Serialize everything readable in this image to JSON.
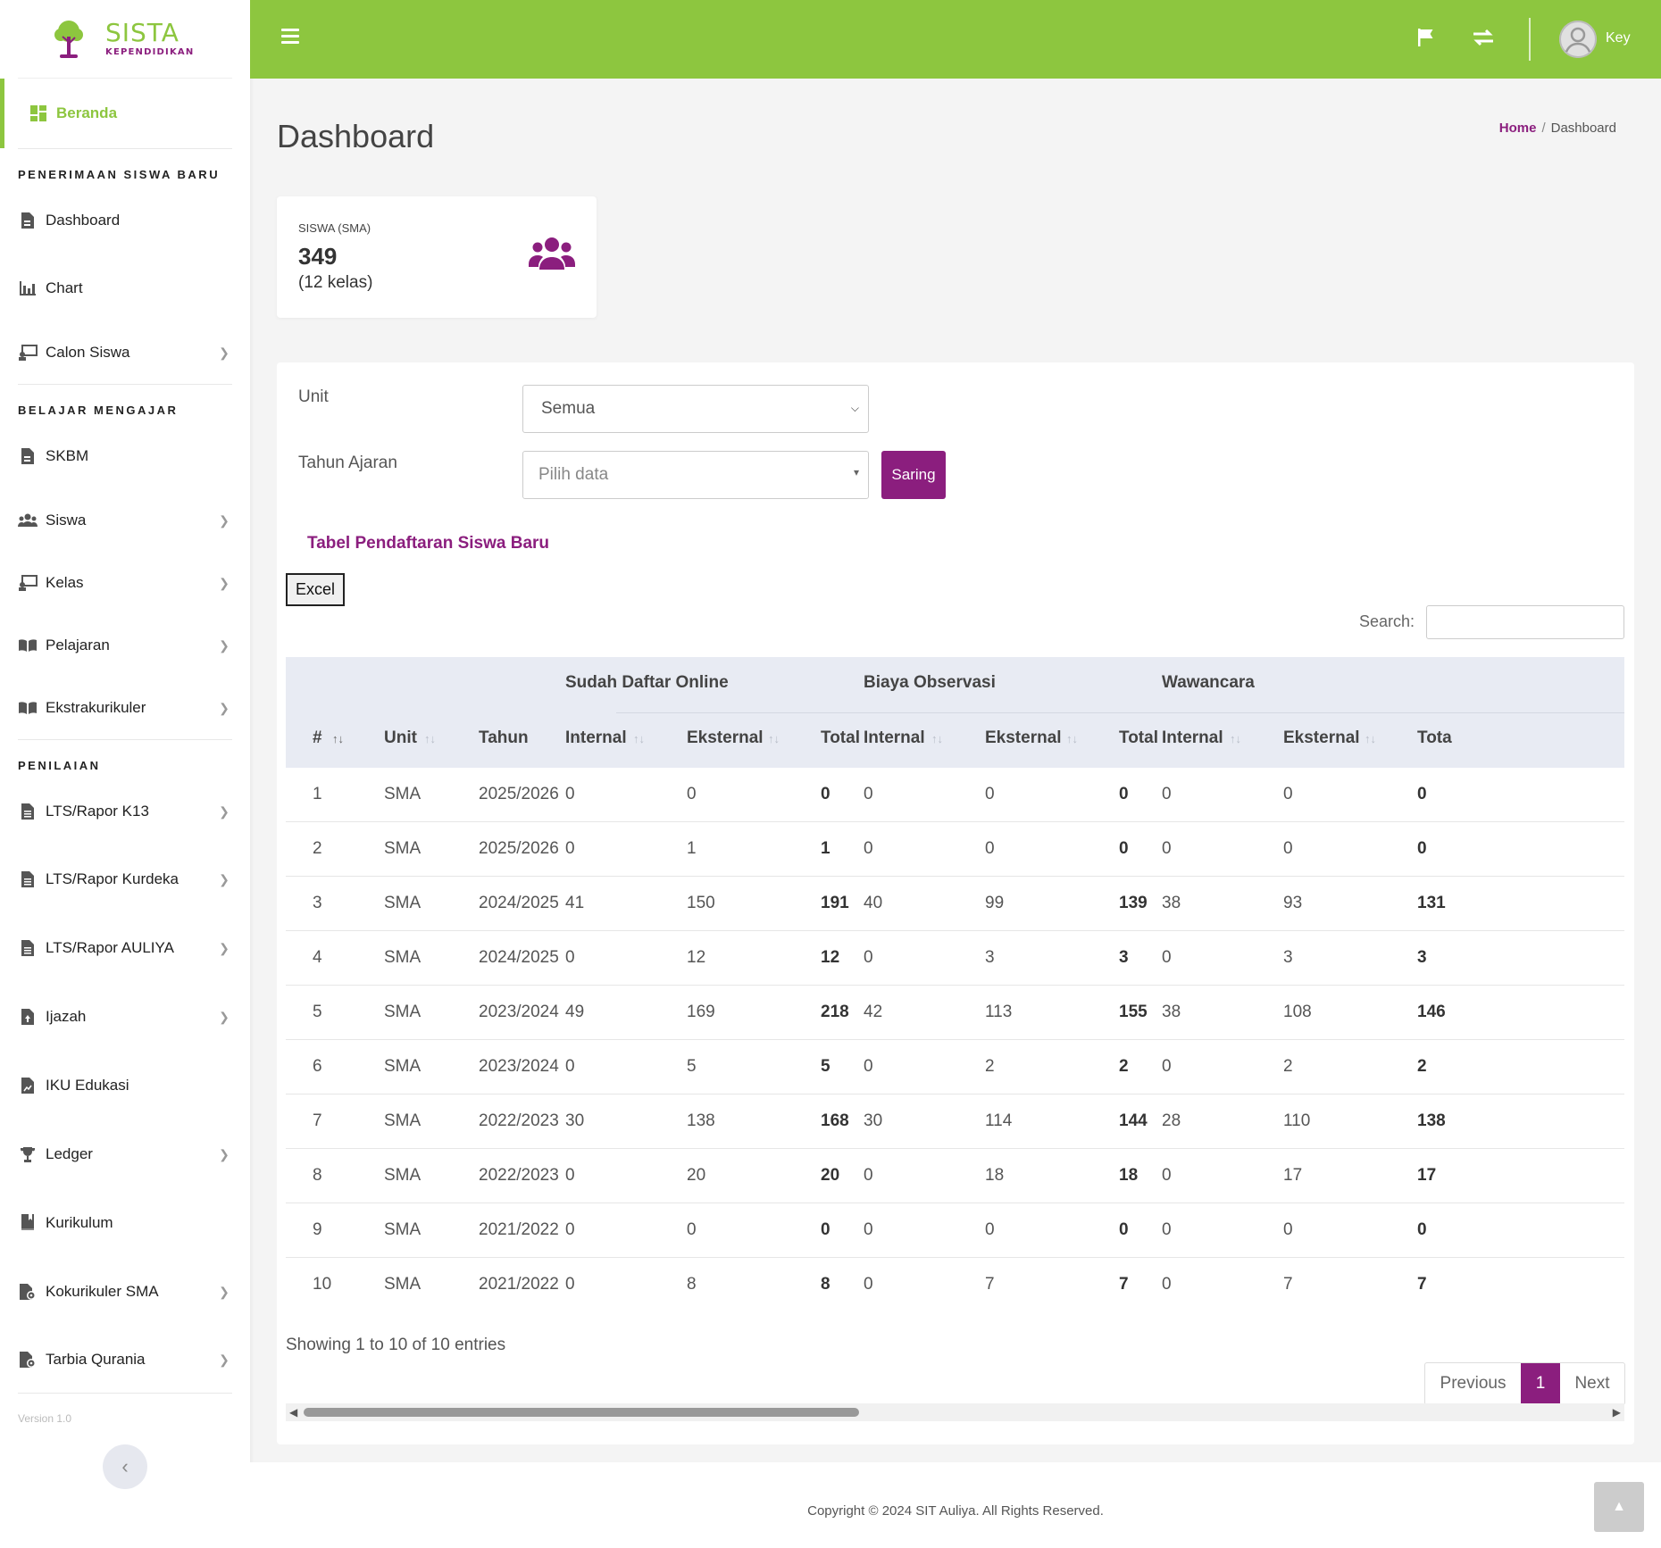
{
  "brand": {
    "title": "SISTA",
    "subtitle": "KEPENDIDIKAN"
  },
  "sidebar": {
    "active": {
      "label": "Beranda",
      "icon": "dashboard-icon"
    },
    "sections": [
      {
        "title": "PENERIMAAN SISWA BARU"
      },
      {
        "title": "BELAJAR MENGAJAR"
      },
      {
        "title": "PENILAIAN"
      }
    ],
    "items": [
      {
        "label": "Dashboard",
        "icon": "file-icon",
        "has_children": false
      },
      {
        "label": "Chart",
        "icon": "bar-chart-icon",
        "has_children": false
      },
      {
        "label": "Calon Siswa",
        "icon": "chalkboard-icon",
        "has_children": true
      },
      {
        "label": "SKBM",
        "icon": "file-icon",
        "has_children": false
      },
      {
        "label": "Siswa",
        "icon": "users-icon",
        "has_children": true
      },
      {
        "label": "Kelas",
        "icon": "chalkboard-icon",
        "has_children": true
      },
      {
        "label": "Pelajaran",
        "icon": "book-icon",
        "has_children": true
      },
      {
        "label": "Ekstrakurikuler",
        "icon": "book-icon",
        "has_children": true
      },
      {
        "label": "LTS/Rapor K13",
        "icon": "file-text-icon",
        "has_children": true
      },
      {
        "label": "LTS/Rapor Kurdeka",
        "icon": "file-text-icon",
        "has_children": true
      },
      {
        "label": "LTS/Rapor AULIYA",
        "icon": "file-text-icon",
        "has_children": true
      },
      {
        "label": "Ijazah",
        "icon": "file-upload-icon",
        "has_children": true
      },
      {
        "label": "IKU Edukasi",
        "icon": "file-chart-icon",
        "has_children": false
      },
      {
        "label": "Ledger",
        "icon": "trophy-icon",
        "has_children": true
      },
      {
        "label": "Kurikulum",
        "icon": "book-bookmark-icon",
        "has_children": false
      },
      {
        "label": "Kokurikuler SMA",
        "icon": "file-gear-icon",
        "has_children": true
      },
      {
        "label": "Tarbia Qurania",
        "icon": "file-gear-icon",
        "has_children": true
      }
    ],
    "version": "Version 1.0"
  },
  "topbar": {
    "user_name": "Key"
  },
  "header": {
    "title": "Dashboard",
    "breadcrumb_home": "Home",
    "breadcrumb_sep": "/",
    "breadcrumb_current": "Dashboard"
  },
  "stat": {
    "label": "SISWA (SMA)",
    "value": "349",
    "sub": "(12 kelas)"
  },
  "filters": {
    "unit_label": "Unit",
    "unit_value": "Semua",
    "tahun_label": "Tahun Ajaran",
    "tahun_placeholder": "Pilih data",
    "submit_label": "Saring"
  },
  "table": {
    "title": "Tabel Pendaftaran Siswa Baru",
    "excel_label": "Excel",
    "search_label": "Search:",
    "groups": [
      "Sudah Daftar Online",
      "Biaya Observasi",
      "Wawancara"
    ],
    "columns": [
      "#",
      "Unit",
      "Tahun",
      "Internal",
      "Eksternal",
      "Total",
      "Internal",
      "Eksternal",
      "Total",
      "Internal",
      "Eksternal",
      "Tota"
    ],
    "rows": [
      [
        "1",
        "SMA",
        "2025/2026",
        "0",
        "0",
        "0",
        "0",
        "0",
        "0",
        "0",
        "0",
        "0"
      ],
      [
        "2",
        "SMA",
        "2025/2026",
        "0",
        "1",
        "1",
        "0",
        "0",
        "0",
        "0",
        "0",
        "0"
      ],
      [
        "3",
        "SMA",
        "2024/2025",
        "41",
        "150",
        "191",
        "40",
        "99",
        "139",
        "38",
        "93",
        "131"
      ],
      [
        "4",
        "SMA",
        "2024/2025",
        "0",
        "12",
        "12",
        "0",
        "3",
        "3",
        "0",
        "3",
        "3"
      ],
      [
        "5",
        "SMA",
        "2023/2024",
        "49",
        "169",
        "218",
        "42",
        "113",
        "155",
        "38",
        "108",
        "146"
      ],
      [
        "6",
        "SMA",
        "2023/2024",
        "0",
        "5",
        "5",
        "0",
        "2",
        "2",
        "0",
        "2",
        "2"
      ],
      [
        "7",
        "SMA",
        "2022/2023",
        "30",
        "138",
        "168",
        "30",
        "114",
        "144",
        "28",
        "110",
        "138"
      ],
      [
        "8",
        "SMA",
        "2022/2023",
        "0",
        "20",
        "20",
        "0",
        "18",
        "18",
        "0",
        "17",
        "17"
      ],
      [
        "9",
        "SMA",
        "2021/2022",
        "0",
        "0",
        "0",
        "0",
        "0",
        "0",
        "0",
        "0",
        "0"
      ],
      [
        "10",
        "SMA",
        "2021/2022",
        "0",
        "8",
        "8",
        "0",
        "7",
        "7",
        "0",
        "7",
        "7"
      ]
    ],
    "info": "Showing 1 to 10 of 10 entries",
    "pagination": {
      "previous": "Previous",
      "current": "1",
      "next": "Next"
    }
  },
  "footer": {
    "text": "Copyright © 2024 SIT Auliya. All Rights Reserved."
  },
  "colors": {
    "primary_green": "#8dc63f",
    "accent_purple": "#8b1e7e"
  }
}
